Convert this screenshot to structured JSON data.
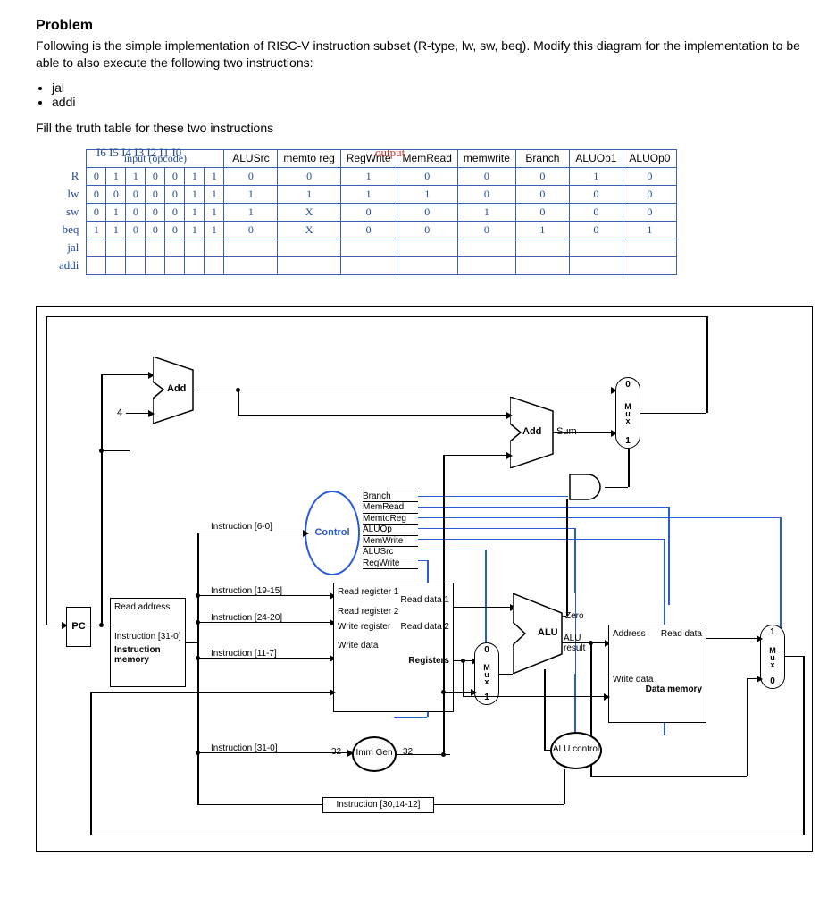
{
  "problem": {
    "heading": "Problem",
    "p1": "Following is the simple implementation of RISC-V instruction subset (R-type, lw, sw, beq). Modify this diagram for the implementation to be able to also execute the following two instructions:",
    "bullets": [
      "jal",
      "addi"
    ],
    "p2": "Fill the truth table for these two instructions"
  },
  "truth_table": {
    "bits_header": "I6  I5  I4  I3  I2  I1  I0",
    "output_header": "output .",
    "col_input_label": "input (opcode)",
    "cols_output": [
      "ALUSrc",
      "memto reg",
      "RegWrite",
      "MemRead",
      "memwrite",
      "Branch",
      "ALUOp1",
      "ALUOp0"
    ],
    "rows": [
      {
        "name": "R",
        "bits": [
          "0",
          "1",
          "1",
          "0",
          "0",
          "1",
          "1"
        ],
        "out": [
          "0",
          "0",
          "1",
          "0",
          "0",
          "0",
          "1",
          "0"
        ]
      },
      {
        "name": "lw",
        "bits": [
          "0",
          "0",
          "0",
          "0",
          "0",
          "1",
          "1"
        ],
        "out": [
          "1",
          "1",
          "1",
          "1",
          "0",
          "0",
          "0",
          "0"
        ]
      },
      {
        "name": "sw",
        "bits": [
          "0",
          "1",
          "0",
          "0",
          "0",
          "1",
          "1"
        ],
        "out": [
          "1",
          "X",
          "0",
          "0",
          "1",
          "0",
          "0",
          "0"
        ]
      },
      {
        "name": "beq",
        "bits": [
          "1",
          "1",
          "0",
          "0",
          "0",
          "1",
          "1"
        ],
        "out": [
          "0",
          "X",
          "0",
          "0",
          "0",
          "1",
          "0",
          "1"
        ]
      },
      {
        "name": "jal",
        "bits": [
          "",
          "",
          "",
          "",
          "",
          "",
          ""
        ],
        "out": [
          "",
          "",
          "",
          "",
          "",
          "",
          "",
          ""
        ]
      },
      {
        "name": "addi",
        "bits": [
          "",
          "",
          "",
          "",
          "",
          "",
          ""
        ],
        "out": [
          "",
          "",
          "",
          "",
          "",
          "",
          "",
          ""
        ]
      }
    ]
  },
  "diagram": {
    "pc": "PC",
    "read_address": "Read address",
    "instr_bus": "Instruction [31-0]",
    "instr_mem": "Instruction memory",
    "constant4": "4",
    "add1": "Add",
    "addsum": "Add",
    "sum": "Sum",
    "mux_top_0": "0",
    "mux_top_1": "1",
    "mux_top_label": "Mux",
    "control": "Control",
    "control_sigs": [
      "Branch",
      "MemRead",
      "MemtoReg",
      "ALUOp",
      "MemWrite",
      "ALUSrc",
      "RegWrite"
    ],
    "instr_6_0": "Instruction [6-0]",
    "instr_19_15": "Instruction [19-15]",
    "instr_24_20": "Instruction [24-20]",
    "instr_11_7": "Instruction [11-7]",
    "instr_31_0": "Instruction [31-0]",
    "instr_30_14_12": "Instruction [30,14-12]",
    "regfile": {
      "rr1": "Read register 1",
      "rr2": "Read register 2",
      "wr": "Write register",
      "wd": "Write data",
      "rd1": "Read data 1",
      "rd2": "Read data 2",
      "title": "Registers"
    },
    "immgen": "Imm Gen",
    "bits32a": "32",
    "bits32b": "32",
    "alu": "ALU",
    "alu_zero": "Zero",
    "alu_result": "ALU result",
    "alu_control": "ALU control",
    "datamem": {
      "addr": "Address",
      "rd": "Read data",
      "wd": "Write data",
      "title": "Data memory"
    },
    "mux_alu_0": "0",
    "mux_alu_1": "1",
    "mux_alu_label": "Mux",
    "mux_wb_0": "0",
    "mux_wb_1": "1",
    "mux_wb_label": "Mux"
  }
}
